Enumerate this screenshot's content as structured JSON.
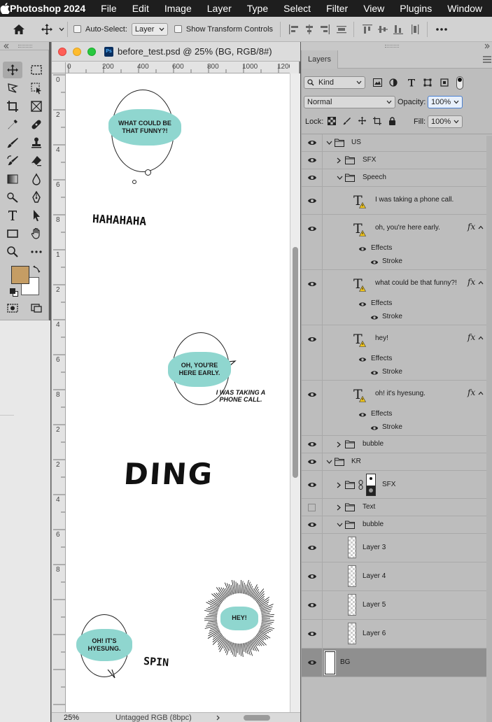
{
  "menubar": {
    "app": "Photoshop 2024",
    "items": [
      "File",
      "Edit",
      "Image",
      "Layer",
      "Type",
      "Select",
      "Filter",
      "View",
      "Plugins",
      "Window"
    ]
  },
  "options": {
    "auto_select_label": "Auto-Select:",
    "auto_select_value": "Layer",
    "transform_label": "Show Transform Controls"
  },
  "colors": {
    "foreground": "#c59d64",
    "background": "#ffffff",
    "bubble_fill": "#8fd6cf"
  },
  "document": {
    "title": "before_test.psd @ 25% (BG, RGB/8#)",
    "zoom": "25%",
    "profile": "Untagged RGB (8bpc)",
    "ruler_h": [
      "0",
      "200",
      "400",
      "600",
      "800",
      "1000",
      "1200"
    ],
    "ruler_v": [
      "0",
      "2",
      "4",
      "6",
      "8",
      "1",
      "2",
      "4",
      "6",
      "8",
      "2",
      "2",
      "4",
      "6",
      "8"
    ]
  },
  "comic": {
    "b1": "WHAT COULD BE THAT FUNNY?!",
    "sfx_haha": "HAHAHAHA",
    "b2": "OH, YOU'RE HERE EARLY.",
    "phone": "I WAS TAKING A PHONE CALL.",
    "ding": "DING",
    "b3": "OH! IT'S HYESUNG.",
    "spin": "SPIN",
    "hey": "HEY!"
  },
  "layers_panel": {
    "tab": "Layers",
    "kind": "Kind",
    "blend": "Normal",
    "opacity_label": "Opacity:",
    "opacity": "100%",
    "lock_label": "Lock:",
    "fill_label": "Fill:",
    "fill": "100%",
    "rows": {
      "us": "US",
      "sfx1": "SFX",
      "speech": "Speech",
      "t1": "I was taking a phone call.",
      "t2": "oh, you're here early.",
      "t3": "what could be that funny?!",
      "t4": "hey!",
      "t5": "oh! it's hyesung.",
      "effects": "Effects",
      "stroke": "Stroke",
      "bubble1": "bubble",
      "kr": "KR",
      "sfx2": "SFX",
      "text": "Text",
      "bubble2": "bubble",
      "layer3": "Layer 3",
      "layer4": "Layer 4",
      "layer5": "Layer 5",
      "layer6": "Layer 6",
      "bg": "BG"
    }
  }
}
